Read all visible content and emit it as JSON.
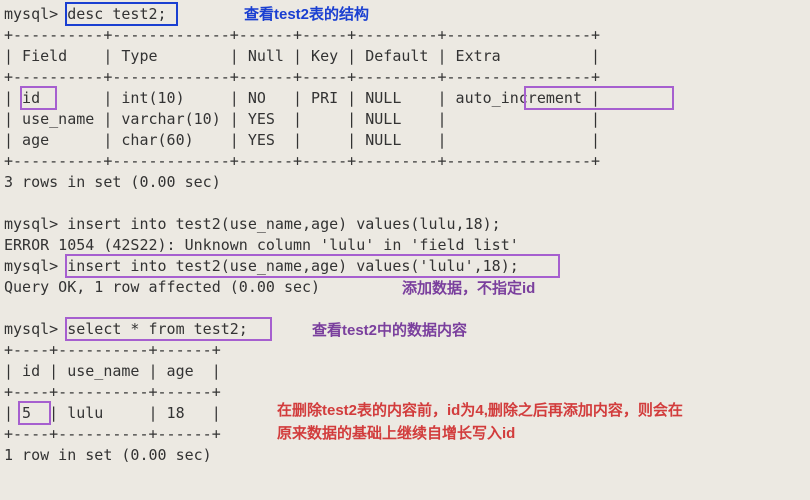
{
  "terminal": {
    "prompt": "mysql>",
    "cmd_desc": "desc test2;",
    "desc_sep_line": "+----------+-------------+------+-----+---------+----------------+",
    "desc_header": "| Field    | Type        | Null | Key | Default | Extra          |",
    "desc_row1": "| id       | int(10)     | NO   | PRI | NULL    | auto_increment |",
    "desc_row2": "| use_name | varchar(10) | YES  |     | NULL    |                |",
    "desc_row3": "| age      | char(60)    | YES  |     | NULL    |                |",
    "desc_summary": "3 rows in set (0.00 sec)",
    "cmd_insert_bad": "insert into test2(use_name,age) values(lulu,18);",
    "insert_error": "ERROR 1054 (42S22): Unknown column 'lulu' in 'field list'",
    "cmd_insert_ok": "insert into test2(use_name,age) values('lulu',18);",
    "insert_result": "Query OK, 1 row affected (0.00 sec)",
    "cmd_select": "select * from test2;",
    "sel_sep_line": "+----+----------+------+",
    "sel_header": "| id | use_name | age  |",
    "sel_row1": "| 5  | lulu     | 18   |",
    "sel_summary": "1 row in set (0.00 sec)"
  },
  "annotations": {
    "note_desc": "查看test2表的结构",
    "note_insert": "添加数据，不指定id",
    "note_select": "查看test2中的数据内容",
    "note_id_line1": "在删除test2表的内容前，id为4,删除之后再添加内容，则会在",
    "note_id_line2": "原来数据的基础上继续自增长写入id"
  }
}
